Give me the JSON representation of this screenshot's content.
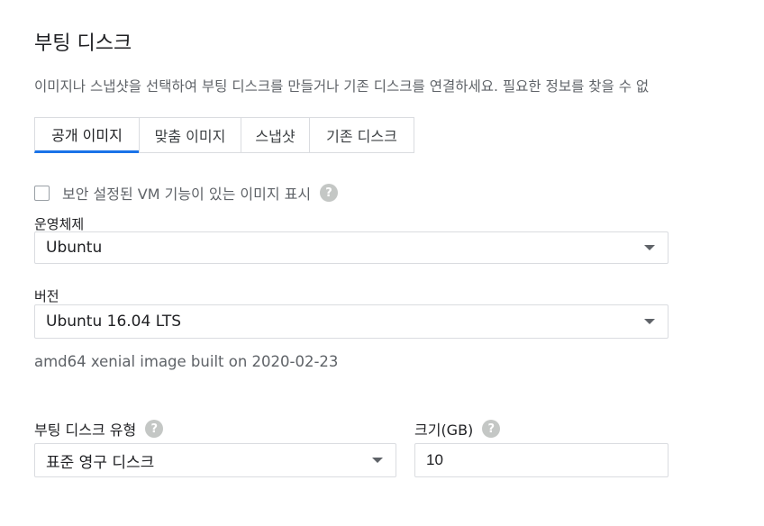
{
  "section": {
    "title": "부팅 디스크",
    "description": "이미지나 스냅샷을 선택하여 부팅 디스크를 만들거나 기존 디스크를 연결하세요. 필요한 정보를 찾을 수 없"
  },
  "tabs": [
    {
      "label": "공개 이미지",
      "active": true
    },
    {
      "label": "맞춤 이미지",
      "active": false
    },
    {
      "label": "스냅샷",
      "active": false
    },
    {
      "label": "기존 디스크",
      "active": false
    }
  ],
  "shielded_vm": {
    "label": "보안 설정된 VM 기능이 있는 이미지 표시",
    "checked": false,
    "help_glyph": "?"
  },
  "os": {
    "label": "운영체제",
    "selected": "Ubuntu"
  },
  "version": {
    "label": "버전",
    "selected": "Ubuntu 16.04 LTS",
    "description": "amd64 xenial image built on 2020-02-23"
  },
  "disk_type": {
    "label": "부팅 디스크 유형",
    "selected": "표준 영구 디스크",
    "help_glyph": "?"
  },
  "disk_size": {
    "label": "크기(GB)",
    "value": "10",
    "help_glyph": "?"
  },
  "colors": {
    "accent": "#1a73e8",
    "border": "#dadce0",
    "muted_text": "#5f6368",
    "help_icon": "#c4c7c5"
  }
}
